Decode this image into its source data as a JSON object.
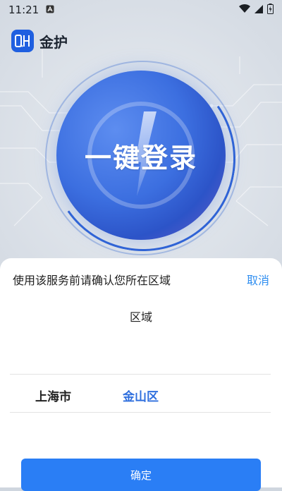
{
  "status_bar": {
    "time": "11:21",
    "notification_icon": "a-badge-icon",
    "icons": [
      "wifi-icon",
      "signal-icon",
      "battery-charging-icon"
    ]
  },
  "app": {
    "title": "金护",
    "logo_icon": "qh-logo-icon"
  },
  "hero": {
    "login_label": "一键登录",
    "bolt_icon": "lightning-bolt-icon"
  },
  "region_sheet": {
    "prompt": "使用该服务前请确认您所在区域",
    "cancel_label": "取消",
    "subtitle": "区域",
    "city": "上海市",
    "district": "金山区",
    "confirm_label": "确定"
  },
  "colors": {
    "accent_blue": "#2a7ef5",
    "link_blue": "#2f8ef0",
    "selected_blue": "#2f6fde"
  }
}
